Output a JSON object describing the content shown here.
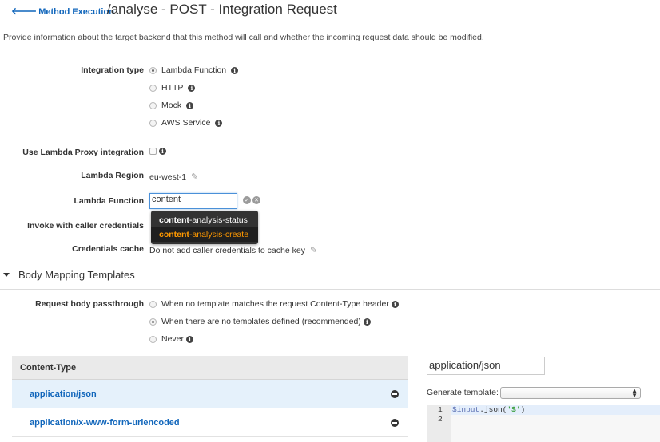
{
  "header": {
    "back_label": "Method Execution",
    "back_arrow": "🡐",
    "title": "/analyse - POST - Integration Request"
  },
  "description": "Provide information about the target backend that this method will call and whether the incoming request data should be modified.",
  "integration": {
    "label": "Integration type",
    "options": [
      "Lambda Function",
      "HTTP",
      "Mock",
      "AWS Service"
    ],
    "selected": "Lambda Function"
  },
  "proxy": {
    "label": "Use Lambda Proxy integration",
    "checked": false
  },
  "region": {
    "label": "Lambda Region",
    "value": "eu-west-1"
  },
  "lambda_function": {
    "label": "Lambda Function",
    "value": "content",
    "suggestions": [
      {
        "match": "content",
        "rest": "-analysis-status"
      },
      {
        "match": "content",
        "rest": "-analysis-create"
      }
    ]
  },
  "invoke": {
    "label": "Invoke with caller credentials"
  },
  "cache": {
    "label": "Credentials cache",
    "value": "Do not add caller credentials to cache key"
  },
  "body_mapping": {
    "title": "Body Mapping Templates",
    "passthrough_label": "Request body passthrough",
    "passthrough_options": [
      "When no template matches the request Content-Type header",
      "When there are no templates defined (recommended)",
      "Never"
    ],
    "passthrough_selected": "When there are no templates defined (recommended)",
    "table_header": "Content-Type",
    "content_types": [
      "application/json",
      "application/x-www-form-urlencoded"
    ],
    "selected_content_type": "application/json",
    "content_type_input": "application/json",
    "generate_label": "Generate template:",
    "generate_value": "",
    "editor_lines": [
      "1",
      "2"
    ],
    "code_var": "$input",
    "code_mid": ".json(",
    "code_str": "'$'",
    "code_end": ")"
  },
  "colors": {
    "link": "#1166bb",
    "highlight": "#ff9900",
    "selected_row": "#e5f1fb"
  }
}
